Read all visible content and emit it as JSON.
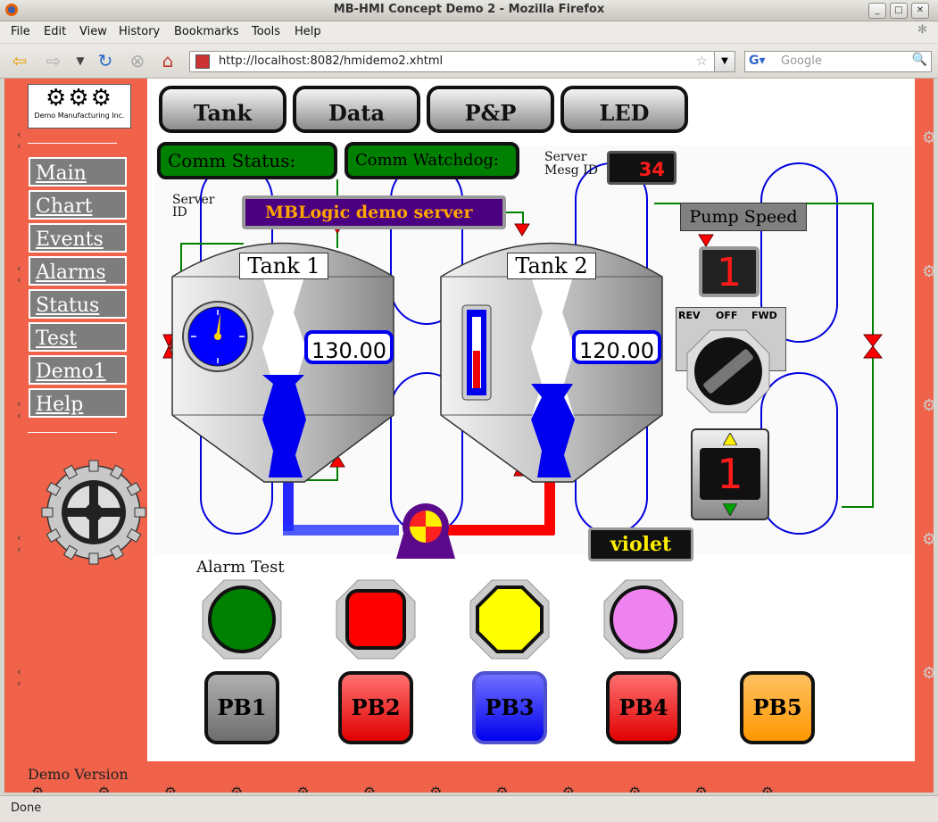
{
  "window": {
    "title": "MB-HMI Concept Demo 2 - Mozilla Firefox"
  },
  "menu": [
    "File",
    "Edit",
    "View",
    "History",
    "Bookmarks",
    "Tools",
    "Help"
  ],
  "address": {
    "url": "http://localhost:8082/hmidemo2.xhtml"
  },
  "search": {
    "placeholder": "Google"
  },
  "logo": {
    "text": "Demo Manufacturing Inc."
  },
  "sidebar": {
    "items": [
      {
        "label": "Main"
      },
      {
        "label": "Chart"
      },
      {
        "label": "Events"
      },
      {
        "label": "Alarms"
      },
      {
        "label": "Status"
      },
      {
        "label": "Test"
      },
      {
        "label": "Demo1"
      },
      {
        "label": "Help"
      }
    ],
    "version": "Demo Version"
  },
  "tabs": [
    {
      "label": "Tank"
    },
    {
      "label": "Data"
    },
    {
      "label": "P&P"
    },
    {
      "label": "LED"
    }
  ],
  "comm": {
    "status_label": "Comm Status:",
    "watchdog_label": "Comm Watchdog:"
  },
  "server": {
    "id_label_1": "Server",
    "id_label_2": "ID",
    "name": "MBLogic demo server",
    "mesg_label_1": "Server",
    "mesg_label_2": "Mesg ID",
    "mesg_id": "34"
  },
  "tanks": [
    {
      "name": "Tank 1",
      "value": "130.00",
      "level": 0.38
    },
    {
      "name": "Tank 2",
      "value": "120.00",
      "level": 0.34
    }
  ],
  "pump": {
    "speed_label": "Pump Speed",
    "speed_value": "1",
    "selector": [
      "REV",
      "OFF",
      "FWD"
    ],
    "stepper_value": "1"
  },
  "color_display": {
    "value": "violet"
  },
  "alarm": {
    "label": "Alarm Test"
  },
  "pilots": [
    {
      "name": "green",
      "color": "#008000",
      "shape": "circle"
    },
    {
      "name": "red",
      "color": "#ff0000",
      "shape": "square"
    },
    {
      "name": "yellow",
      "color": "#ffff00",
      "shape": "octagon"
    },
    {
      "name": "violet",
      "color": "#ee82ee",
      "shape": "circle"
    }
  ],
  "pushbuttons": [
    {
      "label": "PB1",
      "color": "#7d7d7d"
    },
    {
      "label": "PB2",
      "color": "#ff0000"
    },
    {
      "label": "PB3",
      "color": "#0000ff"
    },
    {
      "label": "PB4",
      "color": "#ff0000"
    },
    {
      "label": "PB5",
      "color": "#ffa500"
    }
  ],
  "status": {
    "text": "Done"
  }
}
